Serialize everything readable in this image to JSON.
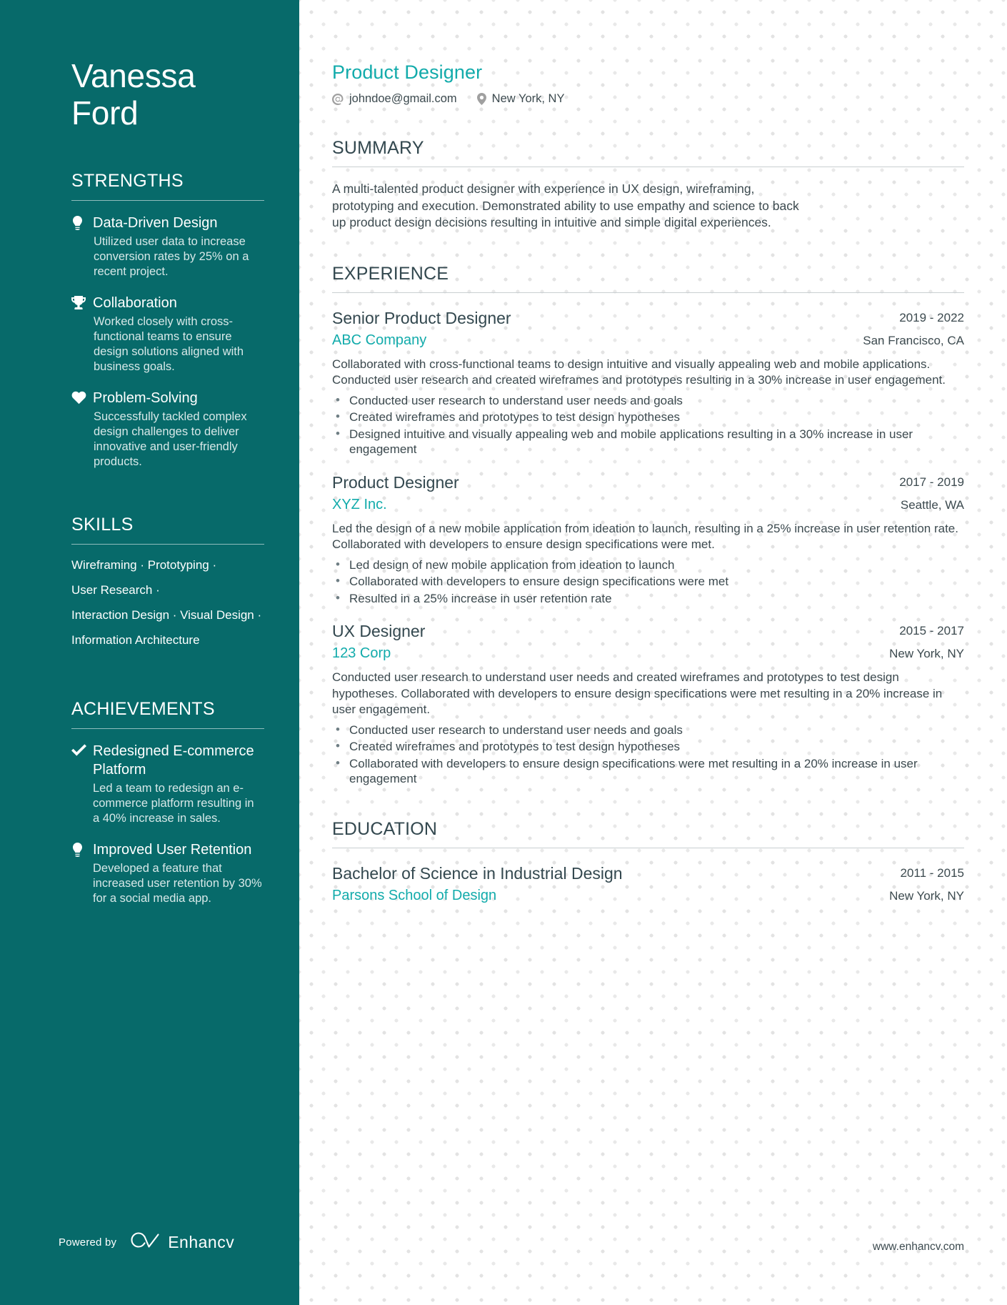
{
  "theme": {
    "sidebar_bg": "#076A6A",
    "accent": "#12ABAB",
    "heading": "#33484f",
    "body": "#3c4a4f"
  },
  "sidebar": {
    "name_first": "Vanessa",
    "name_last": "Ford",
    "strengths": {
      "heading": "STRENGTHS",
      "items": [
        {
          "icon": "lightbulb-icon",
          "title": "Data-Driven Design",
          "description": "Utilized user data to increase conversion rates by 25% on a recent project."
        },
        {
          "icon": "trophy-icon",
          "title": "Collaboration",
          "description": "Worked closely with cross-functional teams to ensure design solutions aligned with business goals."
        },
        {
          "icon": "heart-icon",
          "title": "Problem-Solving",
          "description": "Successfully tackled complex design challenges to deliver innovative and user-friendly products."
        }
      ]
    },
    "skills": {
      "heading": "SKILLS",
      "lines": [
        "Wireframing · Prototyping ·",
        "User Research ·",
        "Interaction Design · Visual Design ·",
        "Information Architecture"
      ]
    },
    "achievements": {
      "heading": "ACHIEVEMENTS",
      "items": [
        {
          "icon": "check-icon",
          "title": "Redesigned E-commerce Platform",
          "description": "Led a team to redesign an e-commerce platform resulting in a 40% increase in sales."
        },
        {
          "icon": "lightbulb-icon",
          "title": "Improved User Retention",
          "description": "Developed a feature that increased user retention by 30% for a social media app."
        }
      ]
    },
    "footer": {
      "powered_by": "Powered by",
      "brand": "Enhancv",
      "logo_icon": "enhancv-infinity-logo"
    }
  },
  "main": {
    "job_title": "Product Designer",
    "contacts": [
      {
        "icon": "at-icon",
        "text": "johndoe@gmail.com"
      },
      {
        "icon": "location-pin-icon",
        "text": "New York, NY"
      }
    ],
    "summary": {
      "heading": "SUMMARY",
      "text": "A multi-talented product designer with experience in UX design, wireframing, prototyping and execution. Demonstrated ability to use empathy and science to back up product design decisions resulting in intuitive and simple digital experiences."
    },
    "experience": {
      "heading": "EXPERIENCE",
      "entries": [
        {
          "role": "Senior Product Designer",
          "date": "2019 - 2022",
          "company": "ABC Company",
          "location": "San Francisco, CA",
          "description": "Collaborated with cross-functional teams to design intuitive and visually appealing web and mobile applications. Conducted user research and created wireframes and prototypes resulting in a 30% increase in user engagement.",
          "bullets": [
            "Conducted user research to understand user needs and goals",
            "Created wireframes and prototypes to test design hypotheses",
            "Designed intuitive and visually appealing web and mobile applications resulting in a 30% increase in user engagement"
          ]
        },
        {
          "role": "Product Designer",
          "date": "2017 - 2019",
          "company": "XYZ Inc.",
          "location": "Seattle, WA",
          "description": "Led the design of a new mobile application from ideation to launch, resulting in a 25% increase in user retention rate. Collaborated with developers to ensure design specifications were met.",
          "bullets": [
            "Led design of new mobile application from ideation to launch",
            "Collaborated with developers to ensure design specifications were met",
            "Resulted in a 25% increase in user retention rate"
          ]
        },
        {
          "role": "UX Designer",
          "date": "2015 - 2017",
          "company": "123 Corp",
          "location": "New York, NY",
          "description": "Conducted user research to understand user needs and created wireframes and prototypes to test design hypotheses. Collaborated with developers to ensure design specifications were met resulting in a 20% increase in user engagement.",
          "bullets": [
            "Conducted user research to understand user needs and goals",
            "Created wireframes and prototypes to test design hypotheses",
            "Collaborated with developers to ensure design specifications were met resulting in a 20% increase in user engagement"
          ]
        }
      ]
    },
    "education": {
      "heading": "EDUCATION",
      "entries": [
        {
          "degree": "Bachelor of Science in Industrial Design",
          "date": "2011 - 2015",
          "school": "Parsons School of Design",
          "location": "New York, NY"
        }
      ]
    },
    "website": "www.enhancv.com"
  }
}
